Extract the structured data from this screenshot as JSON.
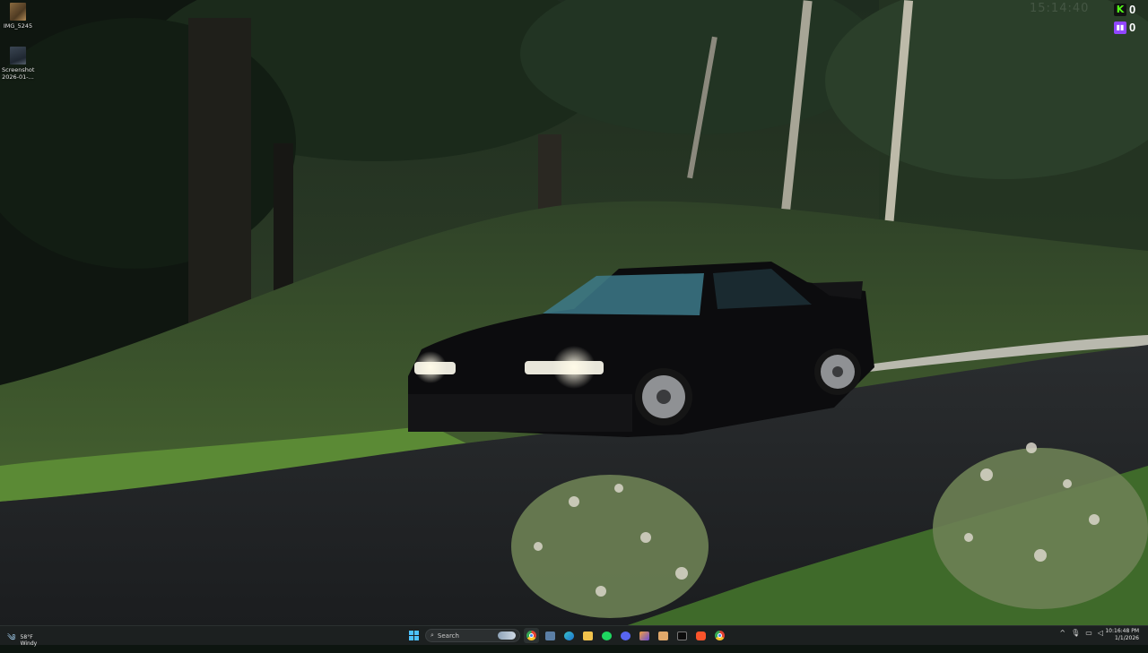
{
  "desktop": {
    "icons": [
      {
        "label": "IMG_5245",
        "icon": "image-file-icon"
      },
      {
        "label": "Screenshot 2026-01-...",
        "icon": "screenshot-file-icon"
      }
    ]
  },
  "overlay": {
    "ghost_clock": "15:14:40",
    "kick_count": "0",
    "twitch_count": "0",
    "kick_color": "#53fc18",
    "twitch_color": "#9146ff"
  },
  "taskbar": {
    "weather": {
      "temp": "58°F",
      "condition": "Windy",
      "icon": "windy-icon"
    },
    "search_placeholder": "Search",
    "apps": [
      {
        "name": "task-view",
        "icon": "task-view-icon"
      },
      {
        "name": "chrome",
        "icon": "chrome-icon"
      },
      {
        "name": "files",
        "icon": "file-explorer-icon"
      },
      {
        "name": "edge",
        "icon": "edge-icon"
      },
      {
        "name": "folder",
        "icon": "folder-icon"
      },
      {
        "name": "spotify",
        "icon": "spotify-icon"
      },
      {
        "name": "discord",
        "icon": "discord-icon"
      },
      {
        "name": "mixer",
        "icon": "app-icon"
      },
      {
        "name": "foreground",
        "icon": "app-icon"
      },
      {
        "name": "terminal",
        "icon": "terminal-icon"
      },
      {
        "name": "brave",
        "icon": "brave-icon"
      },
      {
        "name": "chrome-alt",
        "icon": "chrome-icon"
      }
    ],
    "tray_chevron": "^",
    "time": "10:16:48 PM",
    "date": "1/1/2026"
  }
}
